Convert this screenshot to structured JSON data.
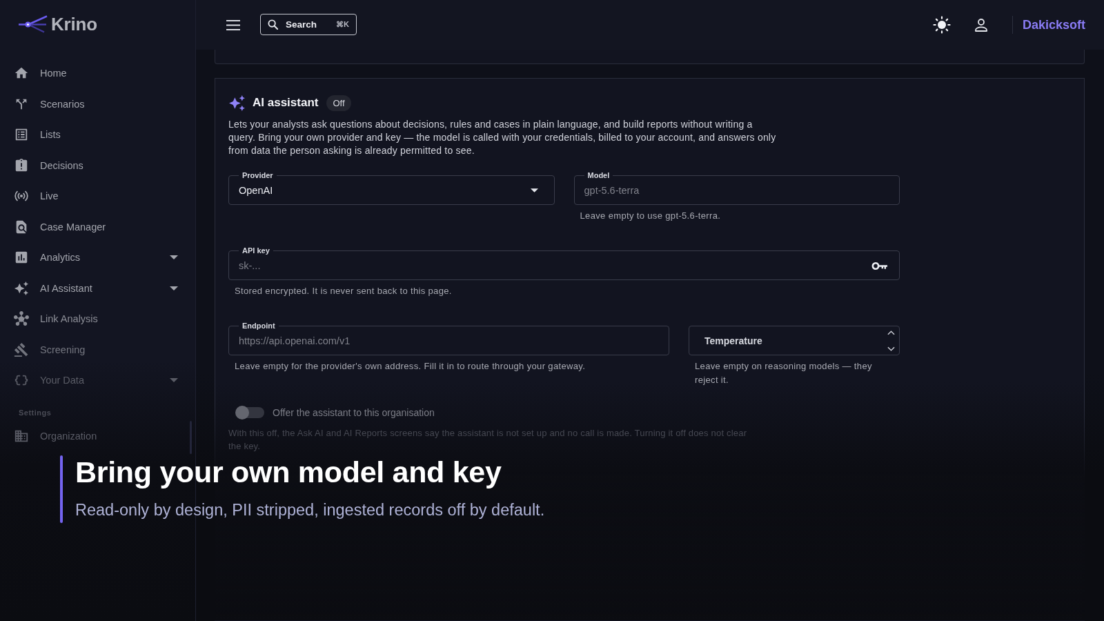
{
  "sidebar": {
    "logo": "Krino",
    "items": [
      {
        "label": "Home",
        "kind": "link"
      },
      {
        "label": "Scenarios",
        "kind": "link"
      },
      {
        "label": "Lists",
        "kind": "link"
      },
      {
        "label": "Decisions",
        "kind": "link"
      },
      {
        "label": "Live",
        "kind": "link"
      },
      {
        "label": "Case Manager",
        "kind": "link"
      },
      {
        "label": "Analytics",
        "kind": "group"
      },
      {
        "label": "AI Assistant",
        "kind": "group"
      },
      {
        "label": "Link Analysis",
        "kind": "link"
      },
      {
        "label": "Screening",
        "kind": "link"
      },
      {
        "label": "Your Data",
        "kind": "group"
      }
    ],
    "section": {
      "title": "Settings",
      "items": [
        {
          "label": "Organization"
        }
      ]
    }
  },
  "topbar": {
    "search": {
      "label": "Search",
      "shortcut": "⌘K"
    },
    "account": "Dakicksoft"
  },
  "ai_card": {
    "title": "AI assistant",
    "status": "Off",
    "description": "Lets your analysts ask questions about decisions, rules and cases in plain language, and build reports without writing a query. Bring your own provider and key — the model is called with your credentials, billed to your account, and answers only from data the person asking is already permitted to see.",
    "rows": [
      {
        "fields": [
          {
            "kind": "select",
            "label": "Provider",
            "value": "OpenAI"
          },
          {
            "kind": "text",
            "label": "Model",
            "placeholder": "gpt-5.6-terra",
            "helper": "Leave empty to use gpt-5.6-terra."
          }
        ]
      },
      {
        "fields": [
          {
            "kind": "secret",
            "label": "API key",
            "placeholder": "sk-...",
            "helper": "Stored encrypted. It is never sent back to this page."
          }
        ]
      },
      {
        "fields": [
          {
            "kind": "text",
            "label": "Endpoint",
            "placeholder": "https://api.openai.com/v1",
            "helper": "Leave empty for the provider's own address. Fill it in to route through your gateway."
          },
          {
            "kind": "number",
            "label": "Temperature",
            "helper": "Leave empty on reasoning models — they reject it."
          }
        ]
      }
    ],
    "toggle": {
      "label": "Offer the assistant to this organisation",
      "on": false,
      "help": "With this off, the Ask AI and AI Reports screens say the assistant is not set up and no call is made. Turning it off does not clear the key."
    }
  },
  "caption": {
    "title": "Bring your own model and key",
    "subtitle": "Read-only by design, PII stripped, ingested records off by default."
  }
}
